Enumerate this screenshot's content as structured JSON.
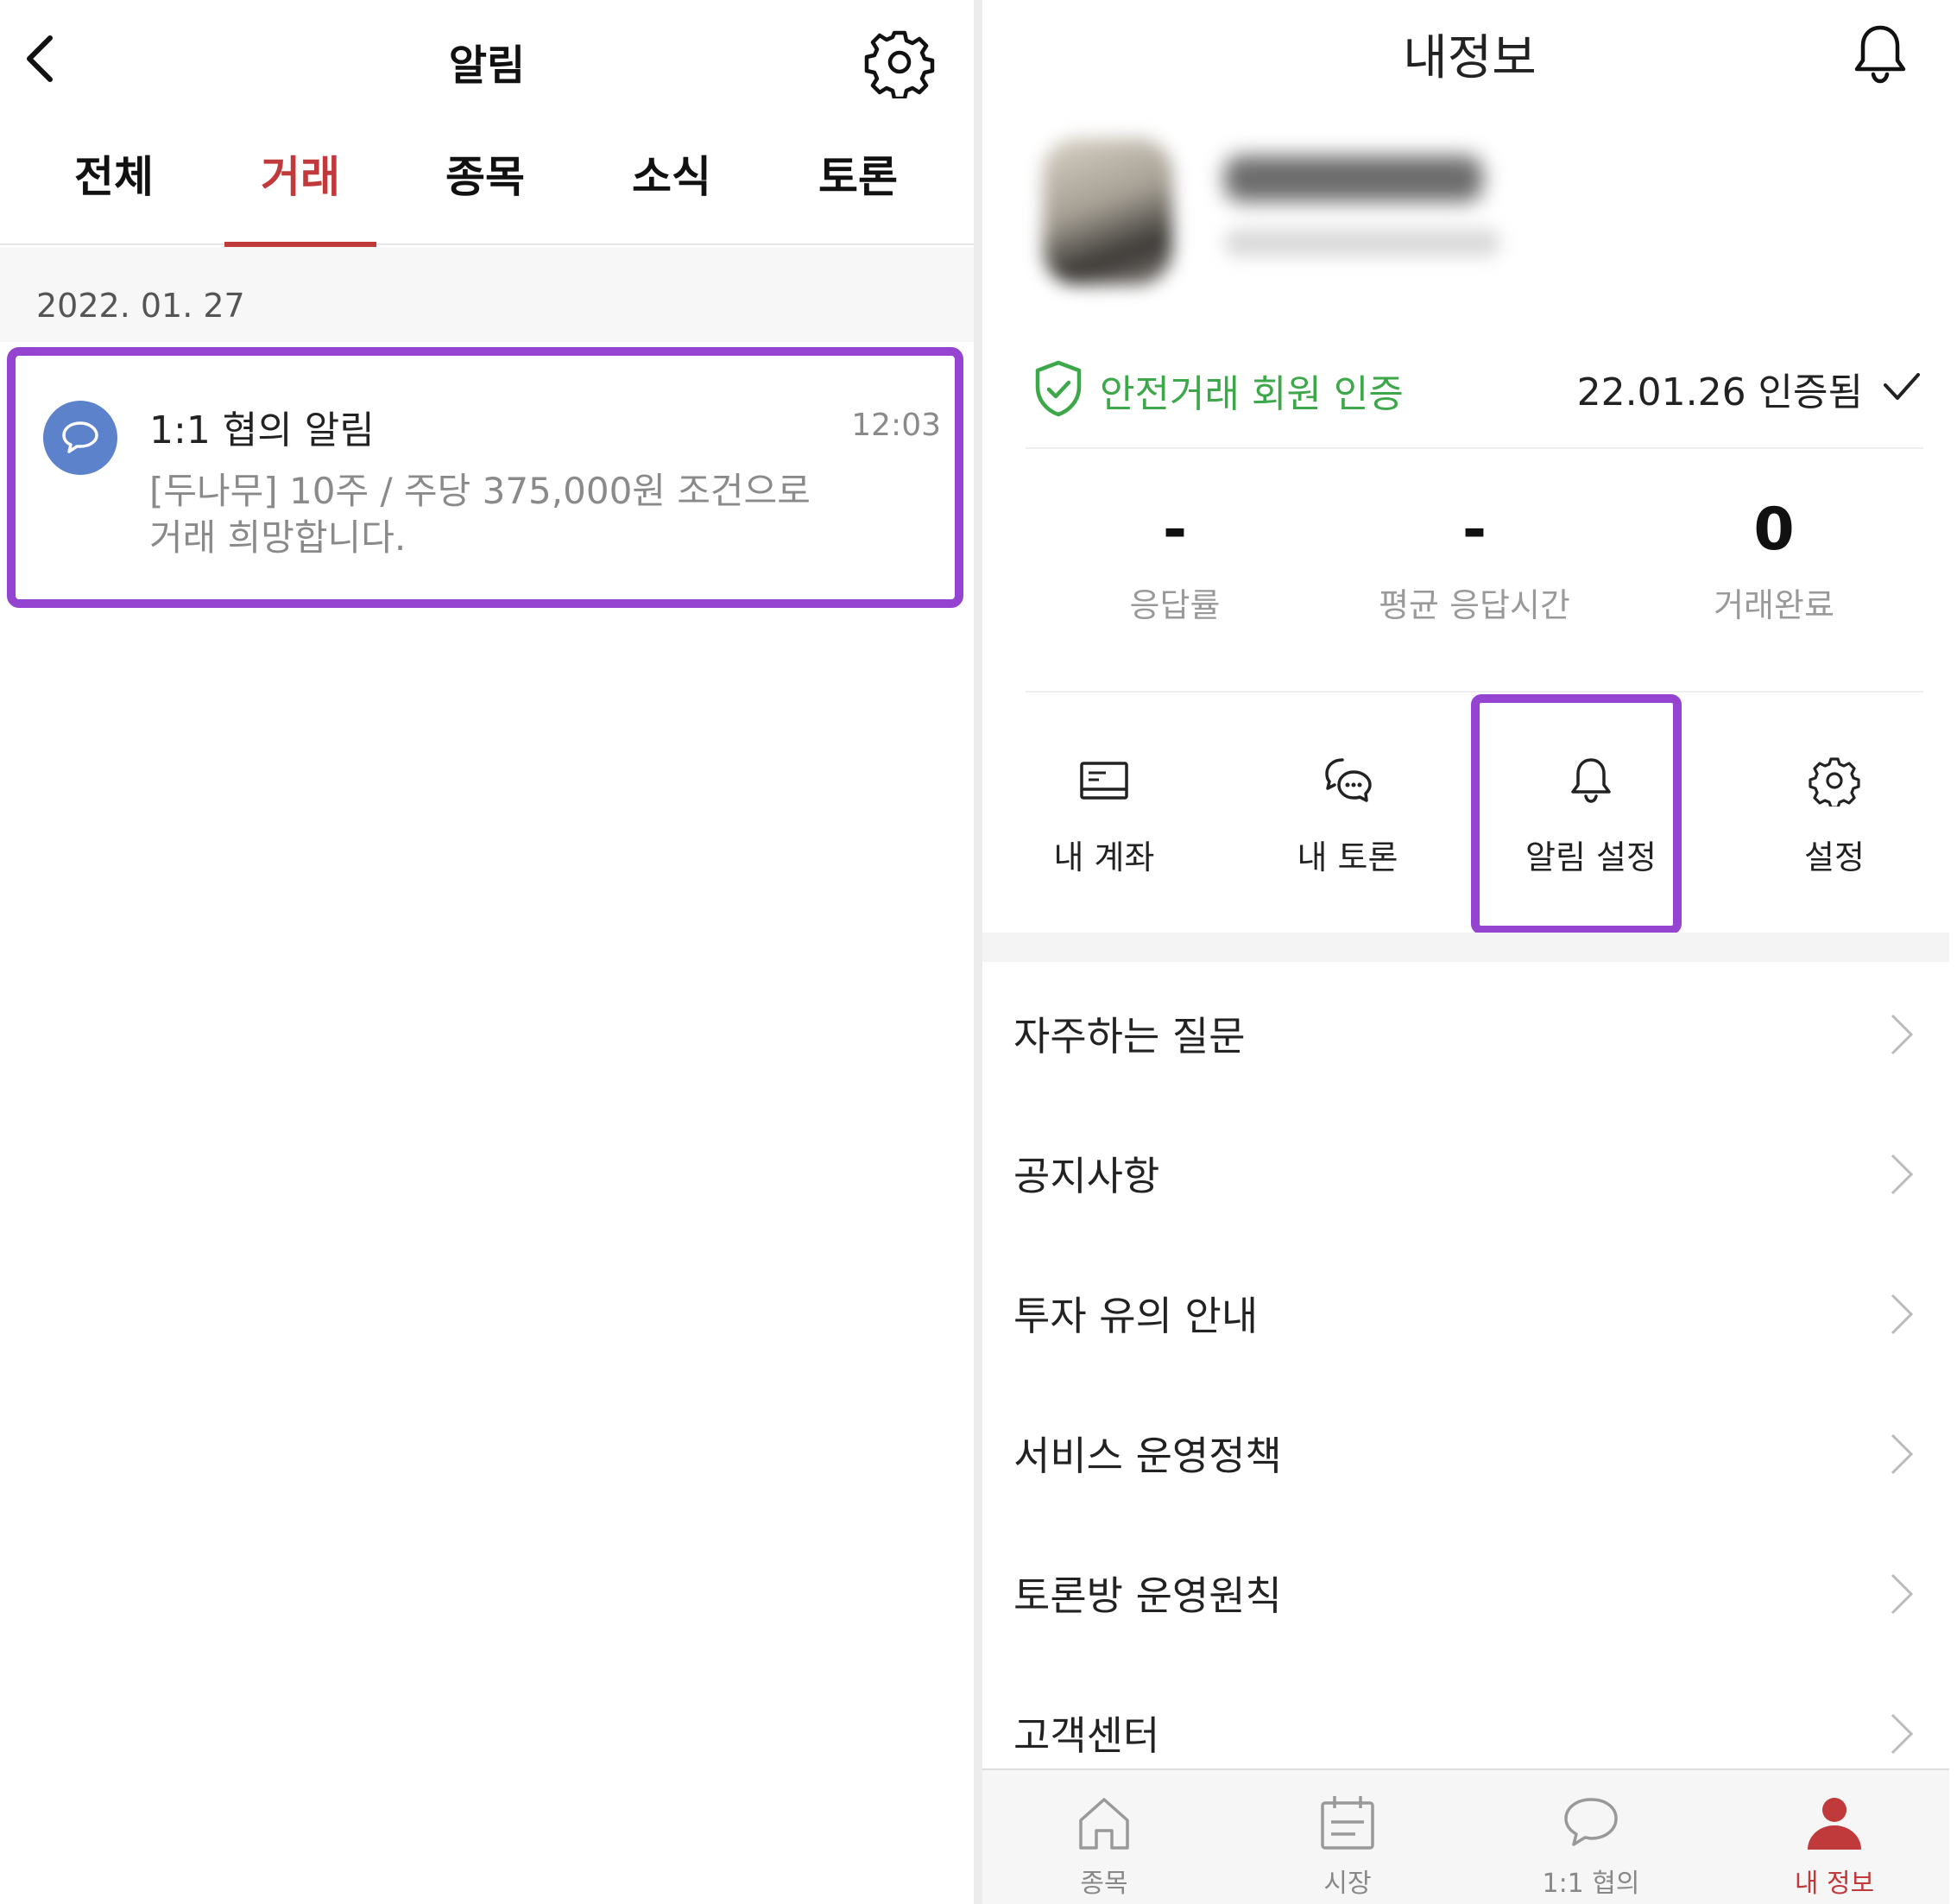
{
  "left": {
    "title": "알림",
    "tabs": [
      {
        "label": "전체",
        "active": false
      },
      {
        "label": "거래",
        "active": true
      },
      {
        "label": "종목",
        "active": false
      },
      {
        "label": "소식",
        "active": false
      },
      {
        "label": "토론",
        "active": false
      }
    ],
    "date": "2022. 01. 27",
    "notification": {
      "title": "1:1 협의 알림",
      "time": "12:03",
      "body_line1": "[두나무] 10주 / 주당 375,000원 조건으로",
      "body_line2": "거래 희망합니다."
    },
    "icons": {
      "back": "chevron-left-icon",
      "settings": "gear-icon",
      "notification": "chat-bubble-icon"
    }
  },
  "right": {
    "title": "내정보",
    "verify": {
      "label": "안전거래 회원 인증",
      "date": "22.01.26 인증됨"
    },
    "stats": [
      {
        "value": "-",
        "label": "응답률"
      },
      {
        "value": "-",
        "label": "평균 응답시간"
      },
      {
        "value": "0",
        "label": "거래완료"
      }
    ],
    "shortcuts": [
      {
        "label": "내 계좌",
        "icon": "account-card-icon"
      },
      {
        "label": "내 토론",
        "icon": "discussion-icon"
      },
      {
        "label": "알림 설정",
        "icon": "bell-icon"
      },
      {
        "label": "설정",
        "icon": "gear-icon"
      }
    ],
    "menu": [
      {
        "label": "자주하는 질문"
      },
      {
        "label": "공지사항"
      },
      {
        "label": "투자 유의 안내"
      },
      {
        "label": "서비스 운영정책"
      },
      {
        "label": "토론방 운영원칙"
      },
      {
        "label": "고객센터"
      }
    ],
    "tabbar": [
      {
        "label": "종목",
        "icon": "home-icon",
        "active": false
      },
      {
        "label": "시장",
        "icon": "calendar-icon",
        "active": false
      },
      {
        "label": "1:1 협의",
        "icon": "chat-bubble-icon",
        "active": false
      },
      {
        "label": "내 정보",
        "icon": "person-icon",
        "active": true
      }
    ]
  },
  "colors": {
    "accent_red": "#c0393b",
    "highlight_purple": "#9444d0",
    "verify_green": "#3da84a",
    "avatar_blue": "#5b82cb"
  }
}
